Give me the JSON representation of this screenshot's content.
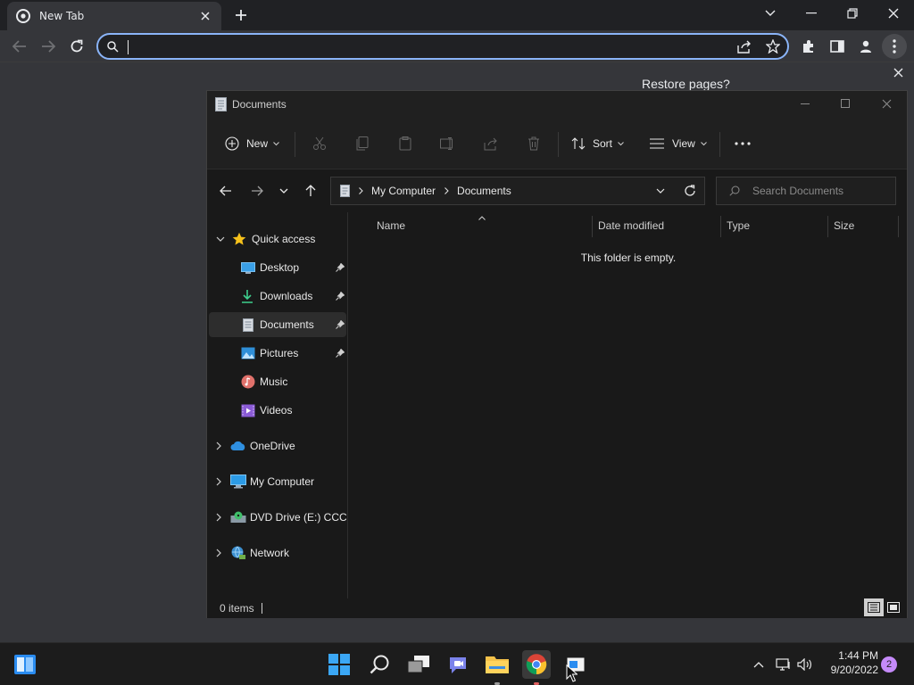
{
  "browser": {
    "tab_title": "New Tab",
    "omnibox_value": "",
    "restore_popup_title": "Restore pages?"
  },
  "explorer": {
    "window_title": "Documents",
    "toolbar": {
      "new_label": "New",
      "sort_label": "Sort",
      "view_label": "View"
    },
    "breadcrumb": [
      "My Computer",
      "Documents"
    ],
    "search_placeholder": "Search Documents",
    "nav": {
      "quick_access": "Quick access",
      "desktop": "Desktop",
      "downloads": "Downloads",
      "documents": "Documents",
      "pictures": "Pictures",
      "music": "Music",
      "videos": "Videos",
      "onedrive": "OneDrive",
      "my_computer": "My Computer",
      "dvd_drive": "DVD Drive (E:) CCCC",
      "network": "Network"
    },
    "columns": {
      "name": "Name",
      "date_modified": "Date modified",
      "type": "Type",
      "size": "Size"
    },
    "empty_message": "This folder is empty.",
    "status_items": "0 items"
  },
  "taskbar": {
    "time": "1:44 PM",
    "date": "9/20/2022",
    "notification_count": "2"
  }
}
